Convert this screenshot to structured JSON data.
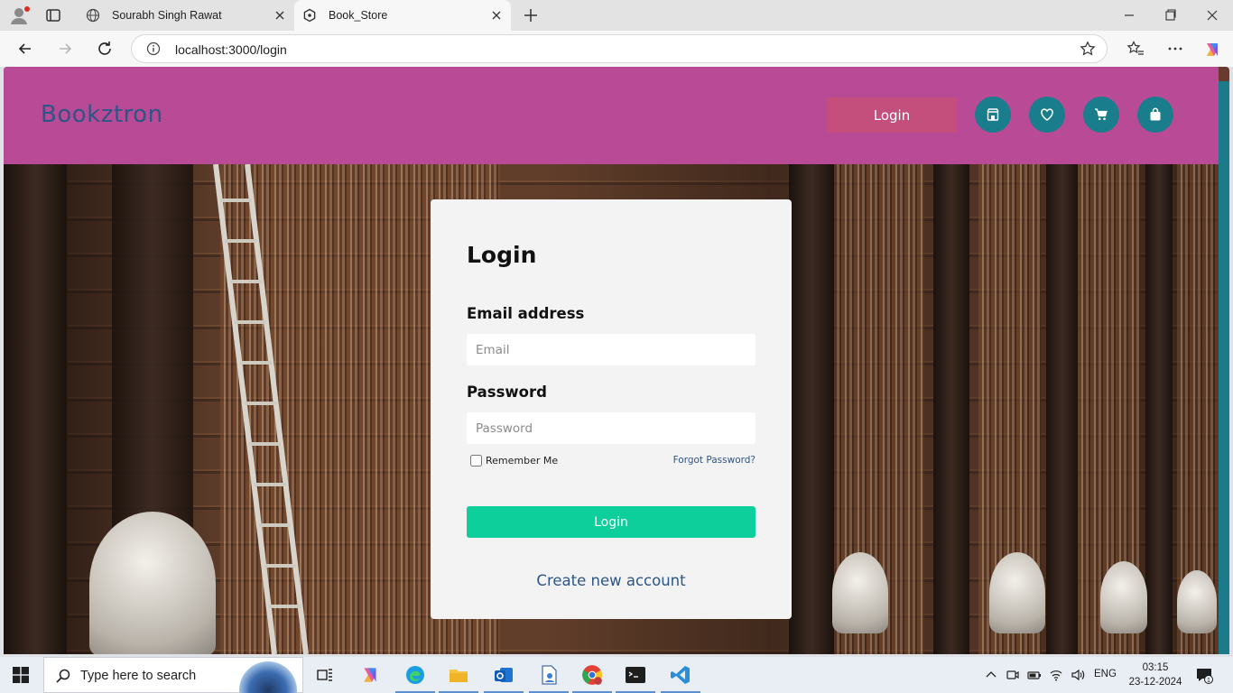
{
  "browser": {
    "tabs": [
      {
        "title": "Sourabh Singh Rawat",
        "icon": "globe-icon",
        "active": false
      },
      {
        "title": "Book_Store",
        "icon": "react-icon",
        "active": true
      }
    ],
    "url": "localhost:3000/login"
  },
  "app": {
    "brand": "Bookztron",
    "nav_login_label": "Login",
    "nav_icons": [
      "store-icon",
      "heart-icon",
      "cart-icon",
      "bag-icon"
    ],
    "colors": {
      "navbar": "#b94a96",
      "brand": "#2d5586",
      "nav_login": "#c44f7c",
      "icon_circle": "#1a7d8c",
      "submit": "#0dcf9b"
    }
  },
  "login": {
    "title": "Login",
    "email_label": "Email address",
    "email_placeholder": "Email",
    "password_label": "Password",
    "password_placeholder": "Password",
    "remember_label": "Remember Me",
    "forgot_label": "Forgot Password?",
    "submit_label": "Login",
    "create_label": "Create new account"
  },
  "taskbar": {
    "search_placeholder": "Type here to search",
    "language": "ENG",
    "time": "03:15",
    "date": "23-12-2024",
    "notifications": "1"
  }
}
